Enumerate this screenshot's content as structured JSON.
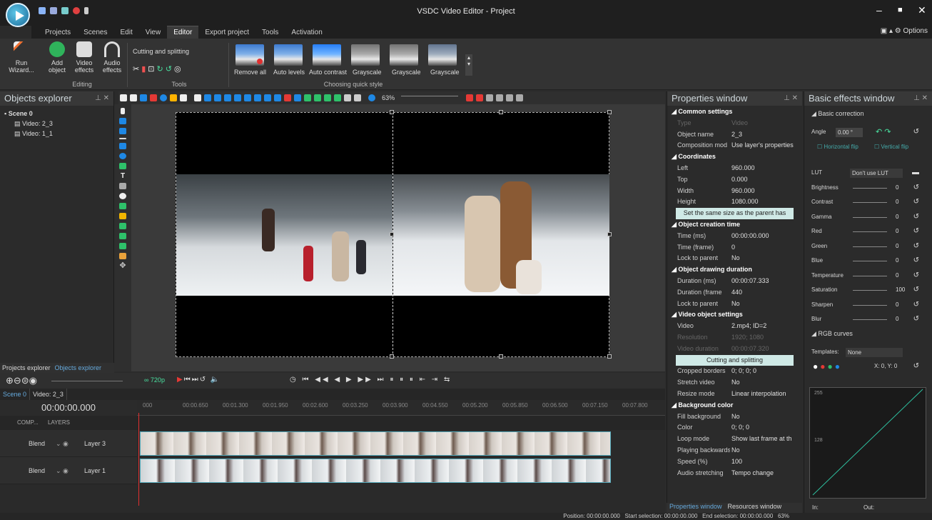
{
  "window": {
    "title": "VSDC Video Editor - Project",
    "minimize": "–",
    "maximize": "■",
    "close": "✕"
  },
  "menu": [
    "Projects",
    "Scenes",
    "Edit",
    "View",
    "Editor",
    "Export project",
    "Tools",
    "Activation"
  ],
  "options_label": "Options",
  "ribbon": {
    "run_wizard": "Run Wizard...",
    "add_object": "Add object",
    "video_effects": "Video effects",
    "audio_effects": "Audio effects",
    "group_editing": "Editing",
    "cutting_splitting": "Cutting and splitting",
    "group_tools": "Tools",
    "quick_styles": [
      "Remove all",
      "Auto levels",
      "Auto contrast",
      "Grayscale",
      "Grayscale",
      "Grayscale"
    ],
    "group_quick": "Choosing quick style"
  },
  "objects_explorer": {
    "title": "Objects explorer",
    "tree": [
      "Scene 0",
      "Video: 2_3",
      "Video: 1_1"
    ],
    "tabs": [
      "Projects explorer",
      "Objects explorer"
    ]
  },
  "toolbar": {
    "zoom": "63%"
  },
  "properties": {
    "title": "Properties window",
    "rows": [
      {
        "k": "Common settings",
        "v": "",
        "t": "sec"
      },
      {
        "k": "Type",
        "v": "Video",
        "t": "dim"
      },
      {
        "k": "Object name",
        "v": "2_3",
        "t": ""
      },
      {
        "k": "Composition mod",
        "v": "Use layer's properties",
        "t": ""
      },
      {
        "k": "Coordinates",
        "v": "",
        "t": "sec"
      },
      {
        "k": "Left",
        "v": "960.000",
        "t": ""
      },
      {
        "k": "Top",
        "v": "0.000",
        "t": ""
      },
      {
        "k": "Width",
        "v": "960.000",
        "t": ""
      },
      {
        "k": "Height",
        "v": "1080.000",
        "t": ""
      },
      {
        "k": "Set the same size as the parent has",
        "v": "",
        "t": "btn"
      },
      {
        "k": "Object creation time",
        "v": "",
        "t": "sec"
      },
      {
        "k": "Time (ms)",
        "v": "00:00:00.000",
        "t": ""
      },
      {
        "k": "Time (frame)",
        "v": "0",
        "t": ""
      },
      {
        "k": "Lock to parent",
        "v": "No",
        "t": ""
      },
      {
        "k": "Object drawing duration",
        "v": "",
        "t": "sec"
      },
      {
        "k": "Duration (ms)",
        "v": "00:00:07.333",
        "t": ""
      },
      {
        "k": "Duration (frame",
        "v": "440",
        "t": ""
      },
      {
        "k": "Lock to parent",
        "v": "No",
        "t": ""
      },
      {
        "k": "Video object settings",
        "v": "",
        "t": "sec"
      },
      {
        "k": "Video",
        "v": "2.mp4; ID=2",
        "t": ""
      },
      {
        "k": "Resolution",
        "v": "1920; 1080",
        "t": "dim"
      },
      {
        "k": "Video duration",
        "v": "00:00:07.320",
        "t": "dim"
      },
      {
        "k": "Cutting and splitting",
        "v": "",
        "t": "btn"
      },
      {
        "k": "Cropped borders",
        "v": "0; 0; 0; 0",
        "t": ""
      },
      {
        "k": "Stretch video",
        "v": "No",
        "t": ""
      },
      {
        "k": "Resize mode",
        "v": "Linear interpolation",
        "t": ""
      },
      {
        "k": "Background color",
        "v": "",
        "t": "sec"
      },
      {
        "k": "Fill background",
        "v": "No",
        "t": ""
      },
      {
        "k": "Color",
        "v": "0; 0; 0",
        "t": ""
      },
      {
        "k": "Loop mode",
        "v": "Show last frame at th",
        "t": ""
      },
      {
        "k": "Playing backwards",
        "v": "No",
        "t": ""
      },
      {
        "k": "Speed (%)",
        "v": "100",
        "t": ""
      },
      {
        "k": "Audio stretching",
        "v": "Tempo change",
        "t": ""
      }
    ],
    "tabs": [
      "Properties window",
      "Resources window"
    ]
  },
  "effects": {
    "title": "Basic effects window",
    "section": "Basic correction",
    "angle_label": "Angle",
    "angle_value": "0.00 °",
    "hflip": "Horizontal flip",
    "vflip": "Vertical flip",
    "lut_label": "LUT",
    "lut_value": "Don't use LUT",
    "sliders": [
      {
        "k": "Brightness",
        "v": "0"
      },
      {
        "k": "Contrast",
        "v": "0"
      },
      {
        "k": "Gamma",
        "v": "0"
      },
      {
        "k": "Red",
        "v": "0"
      },
      {
        "k": "Green",
        "v": "0"
      },
      {
        "k": "Blue",
        "v": "0"
      },
      {
        "k": "Temperature",
        "v": "0"
      },
      {
        "k": "Saturation",
        "v": "100"
      },
      {
        "k": "Sharpen",
        "v": "0"
      },
      {
        "k": "Blur",
        "v": "0"
      }
    ],
    "rgb": "RGB curves",
    "templates_label": "Templates:",
    "templates_value": "None",
    "xy": "X: 0, Y: 0",
    "curve_top": "255",
    "curve_mid": "128",
    "in_label": "In:",
    "out_label": "Out:"
  },
  "timeline": {
    "resolution": "720p",
    "tabs": [
      "Scene 0",
      "Video: 2_3"
    ],
    "time": "00:00:00.000",
    "ticks": [
      "000",
      "00:00.650",
      "00:01.300",
      "00:01.950",
      "00:02.600",
      "00:03.250",
      "00:03.900",
      "00:04.550",
      "00:05.200",
      "00:05.850",
      "00:06.500",
      "00:07.150",
      "00:07.800"
    ],
    "header_comp": "COMP...",
    "header_layers": "LAYERS",
    "layers": [
      {
        "blend": "Blend",
        "name": "Layer 3"
      },
      {
        "blend": "Blend",
        "name": "Layer 1"
      }
    ]
  },
  "status": {
    "position": "Position:",
    "position_v": "00:00:00.000",
    "start": "Start selection:",
    "start_v": "00:00:00.000",
    "end": "End selection:",
    "end_v": "00:00:00.000",
    "zoom": "63%"
  }
}
